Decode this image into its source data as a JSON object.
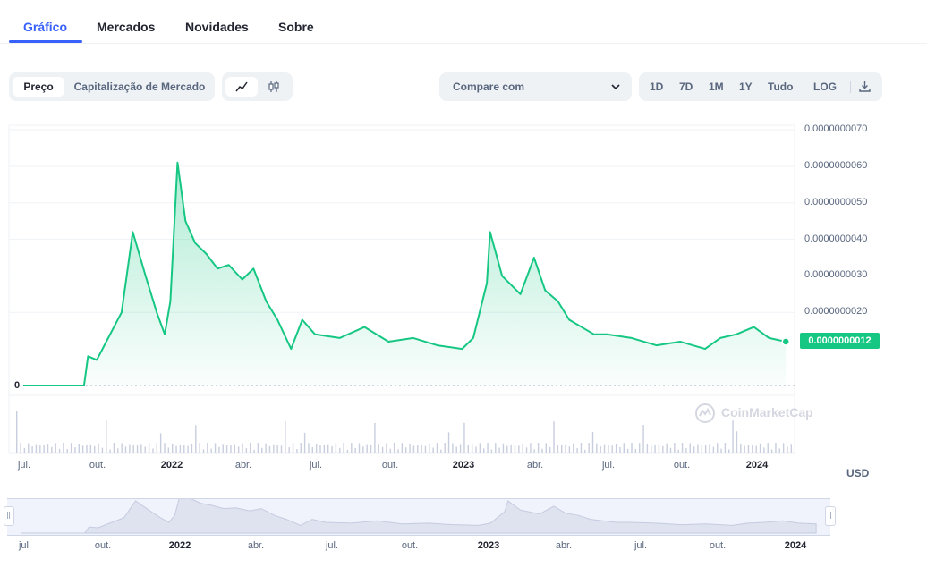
{
  "tabs": [
    "Gráfico",
    "Mercados",
    "Novidades",
    "Sobre"
  ],
  "toolbar": {
    "view_options": [
      "Preço",
      "Capitalização de Mercado"
    ],
    "chart_type_icons": [
      "line-chart-icon",
      "candlestick-icon"
    ],
    "compare_label": "Compare com",
    "ranges": [
      "1D",
      "7D",
      "1M",
      "1Y",
      "Tudo"
    ],
    "log_label": "LOG",
    "download_icon": "download-icon"
  },
  "colors": {
    "accent": "#3861fb",
    "line": "#16c784",
    "zero_line": "#ea3943"
  },
  "price_label": "0.0000000012",
  "zero_label": "0",
  "currency": "USD",
  "watermark": "CoinMarketCap",
  "chart_data": {
    "type": "area",
    "y_tick_labels": [
      "0.0000000070",
      "0.0000000060",
      "0.0000000050",
      "0.0000000040",
      "0.0000000030",
      "0.0000000020"
    ],
    "ylim": [
      0,
      7e-09
    ],
    "x_tick_labels": [
      "jul.",
      "out.",
      "2022",
      "abr.",
      "jul.",
      "out.",
      "2023",
      "abr.",
      "jul.",
      "out.",
      "2024"
    ],
    "navigator_x_tick_labels": [
      "jul.",
      "out.",
      "2022",
      "abr.",
      "jul.",
      "out.",
      "2023",
      "abr.",
      "jul.",
      "out.",
      "2024"
    ],
    "x": [
      "2021-07-01",
      "2021-09-15",
      "2021-09-20",
      "2021-10-01",
      "2021-10-20",
      "2021-11-01",
      "2021-11-15",
      "2021-12-01",
      "2021-12-15",
      "2021-12-25",
      "2022-01-01",
      "2022-01-10",
      "2022-01-20",
      "2022-02-01",
      "2022-02-15",
      "2022-03-01",
      "2022-03-15",
      "2022-04-01",
      "2022-04-15",
      "2022-05-01",
      "2022-05-15",
      "2022-06-01",
      "2022-06-15",
      "2022-07-01",
      "2022-08-01",
      "2022-09-01",
      "2022-10-01",
      "2022-11-01",
      "2022-12-01",
      "2023-01-01",
      "2023-01-15",
      "2023-02-01",
      "2023-02-05",
      "2023-02-20",
      "2023-03-15",
      "2023-04-01",
      "2023-04-15",
      "2023-05-01",
      "2023-05-15",
      "2023-06-15",
      "2023-07-01",
      "2023-08-01",
      "2023-09-01",
      "2023-10-01",
      "2023-11-01",
      "2023-11-20",
      "2023-12-10",
      "2024-01-01",
      "2024-01-20",
      "2024-02-10"
    ],
    "series": [
      {
        "values": [
          0,
          0,
          8e-10,
          7e-10,
          1.5e-09,
          2e-09,
          4.2e-09,
          3e-09,
          2e-09,
          1.4e-09,
          2.3e-09,
          6.1e-09,
          4.5e-09,
          3.9e-09,
          3.6e-09,
          3.2e-09,
          3.3e-09,
          2.9e-09,
          3.2e-09,
          2.3e-09,
          1.8e-09,
          1e-09,
          1.8e-09,
          1.4e-09,
          1.3e-09,
          1.6e-09,
          1.2e-09,
          1.3e-09,
          1.1e-09,
          1e-09,
          1.3e-09,
          2.8e-09,
          4.2e-09,
          3e-09,
          2.5e-09,
          3.5e-09,
          2.6e-09,
          2.3e-09,
          1.8e-09,
          1.4e-09,
          1.4e-09,
          1.3e-09,
          1.1e-09,
          1.2e-09,
          1e-09,
          1.3e-09,
          1.4e-09,
          1.6e-09,
          1.3e-09,
          1.2e-09
        ]
      }
    ]
  }
}
